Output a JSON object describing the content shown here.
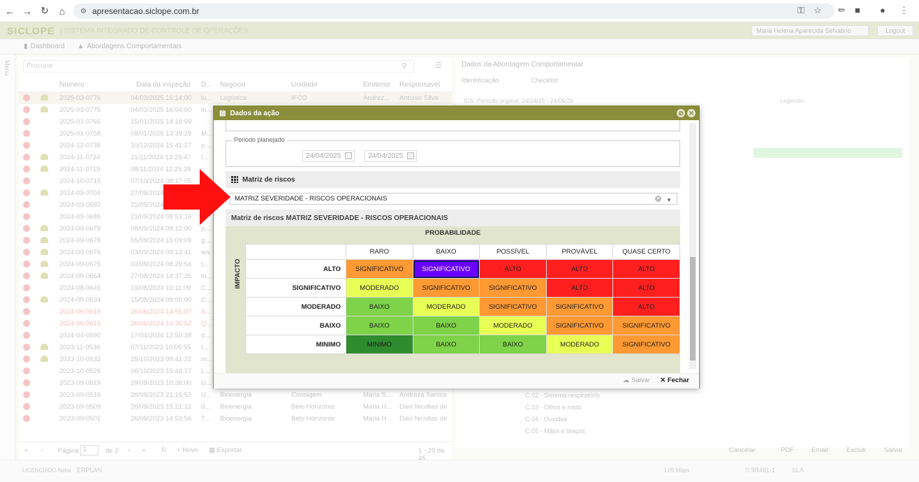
{
  "browser": {
    "url": "apresentacao.siclope.com.br"
  },
  "app": {
    "logo": "SICLOPE",
    "title": "| SISTEMA INTEGRADO DE CONTROLE DE OPERAÇÕES",
    "user": "Maria Helena Aparecida Selvatino",
    "logout": "Logout",
    "menu_label": "Menu",
    "tabs": [
      "Dashboard",
      "Abordagens Comportamentais"
    ],
    "search_placeholder": "Procurar",
    "columns": [
      "Número",
      "Data da inspeção",
      "D...",
      "Negócio",
      "Unidade",
      "Emitente",
      "Responsavel"
    ],
    "rows": [
      [
        "2025-03-0776",
        "04/03/2025 16:14:00",
        "lo...",
        "Logística",
        "IFCO",
        "Andrez...",
        "Antonio Silva"
      ],
      [
        "2025-03-0775",
        "04/03/2025 16:04:50",
        "lo...",
        "",
        "",
        "",
        ""
      ],
      [
        "2025-01-0765",
        "15/01/2025 14:19:59",
        "",
        "",
        "",
        "",
        ""
      ],
      [
        "2025-01-0758",
        "08/01/2025 13:39:29",
        "M...",
        "",
        "",
        "",
        ""
      ],
      [
        "2024-12-0738",
        "10/12/2024 15:41:27",
        "p...",
        "",
        "",
        "",
        ""
      ],
      [
        "2024-11-0724",
        "21/11/2024 13:25:47",
        "t...",
        "",
        "",
        "",
        ""
      ],
      [
        "2024-11-0719",
        "08/11/2024 12:25:29",
        "",
        "",
        "",
        "",
        ""
      ],
      [
        "2024-10-0715",
        "07/10/2024 08:17:05",
        "",
        "",
        "",
        "",
        ""
      ],
      [
        "2024-09-0704",
        "27/09/2024",
        "",
        "",
        "",
        "",
        ""
      ],
      [
        "2024-09-0692",
        "21/09/2024",
        "",
        "",
        "",
        "",
        ""
      ],
      [
        "2024-09-0686",
        "21/09/2024 08:53:16",
        "",
        "",
        "",
        "",
        ""
      ],
      [
        "2024-09-0679",
        "08/09/2024 08:12:00",
        "p...",
        "",
        "",
        "",
        ""
      ],
      [
        "2024-09-0678",
        "05/09/2024 15:09:09",
        "g...",
        "",
        "",
        "",
        ""
      ],
      [
        "2024-09-0676",
        "03/09/2024 09:13:41",
        "tes",
        "",
        "",
        "",
        ""
      ],
      [
        "2024-09-0675",
        "03/09/2024 08:29:54",
        "t...",
        "",
        "",
        "",
        ""
      ],
      [
        "2024-08-0664",
        "27/08/2024 14:37:26",
        "lo...",
        "",
        "",
        "",
        ""
      ],
      [
        "2024-08-0641",
        "19/08/2024 10:11:09",
        "C...",
        "",
        "",
        "",
        ""
      ],
      [
        "2024-08-0634",
        "15/08/2024 09:00:00",
        "C...",
        "",
        "",
        "",
        ""
      ],
      [
        "2024-06-0618",
        "26/06/2024 14:55:07",
        "S...",
        "",
        "",
        "",
        ""
      ],
      [
        "2024-06-0615",
        "26/06/2024 14:35:52",
        "Q...",
        "",
        "",
        "",
        ""
      ],
      [
        "2024-04-0590",
        "17/04/2024 12:50:38",
        "d...",
        "",
        "",
        "",
        ""
      ],
      [
        "2023-11-0536",
        "07/11/2023 10:05:55",
        "t...",
        "",
        "",
        "",
        ""
      ],
      [
        "2023-10-0532",
        "25/10/2023 09:41:22",
        "m...",
        "",
        "",
        "",
        ""
      ],
      [
        "2023-10-0526",
        "06/10/2023 15:44:17",
        "L...",
        "",
        "",
        "",
        ""
      ],
      [
        "2023-09-0519",
        "29/09/2023 10:38:00",
        "U...",
        "",
        "",
        "",
        ""
      ],
      [
        "2023-09-0516",
        "28/09/2023 21:16:53",
        "U...",
        "Bioenergia",
        "Contagem",
        "Maria S...",
        "Andreza Santos"
      ],
      [
        "2023-09-0509",
        "26/09/2023 15:21:12",
        "d...",
        "Bioenergia",
        "Belo Horizonte",
        "Maria H...",
        "Davi Nicollas de"
      ],
      [
        "2023-09-0501",
        "26/09/2023 14:53:56",
        "T...",
        "Bioenergia",
        "Belo Horizonte",
        "Maria H...",
        "Davi Nicollas de"
      ]
    ],
    "pager": {
      "page_label": "Página",
      "page": "1",
      "of": "de 2",
      "new": "Novo",
      "export": "Exportar",
      "count": "1 - 29 de 45"
    },
    "right": {
      "title": "Dados da Abordagem Comportamental",
      "tabs": [
        "Identificação",
        "Checklist"
      ],
      "ics": "ICS:   Período original: 24/04/25 - 24/06/25",
      "legend": "Legenda:",
      "checklist": [
        "C.02 - Sistema respiratório",
        "C.03 - Olhos e rosto",
        "C.04 - Ouvidos",
        "C.05 - Mãos e braços"
      ],
      "buttons": [
        "Cancelar",
        "PDF",
        "Email",
        "Excluir",
        "Salvar"
      ]
    },
    "status": {
      "left": "LICENCIADO Nsba",
      "brand": "ERPLAN",
      "speed": "1.09 Mbps",
      "version": "0.9R481-1",
      "sla": "SLA"
    }
  },
  "dialog": {
    "title": "Dados da ação",
    "periodo_label": "Periodo planejado",
    "date_start": "24/04/2025",
    "date_end": "24/04/2025",
    "matriz_title": "Matriz de riscos",
    "matriz_selected": "MATRIZ SEVERIDADE - RISCOS OPERACIONAIS",
    "matriz_subtitle": "Matriz de riscos MATRIZ SEVERIDADE - RISCOS OPERACIONAIS",
    "prob_label": "PROBABILIDADE",
    "impact_label": "IMPACTO",
    "salvar": "Salvar",
    "fechar": "Fechar"
  },
  "risk_matrix": {
    "columns": [
      "RARO",
      "BAIXO",
      "POSSÍVEL",
      "PROVÁVEL",
      "QUASE CERTO"
    ],
    "rows": [
      {
        "label": "ALTO",
        "cells": [
          "SIGNIFICATIVO",
          "SIGNIFICATIVO",
          "ALTO",
          "ALTO",
          "ALTO"
        ]
      },
      {
        "label": "SIGNIFICATIVO",
        "cells": [
          "MODERADO",
          "SIGNIFICATIVO",
          "SIGNIFICATIVO",
          "ALTO",
          "ALTO"
        ]
      },
      {
        "label": "MODERADO",
        "cells": [
          "BAIXO",
          "MODERADO",
          "SIGNIFICATIVO",
          "SIGNIFICATIVO",
          "ALTO"
        ]
      },
      {
        "label": "BAIXO",
        "cells": [
          "BAIXO",
          "BAIXO",
          "MODERADO",
          "SIGNIFICATIVO",
          "SIGNIFICATIVO"
        ]
      },
      {
        "label": "MINIMO",
        "cells": [
          "MINIMO",
          "BAIXO",
          "BAIXO",
          "MODERADO",
          "SIGNIFICATIVO"
        ]
      }
    ],
    "selected": {
      "row": 0,
      "col": 1
    },
    "colors": {
      "ALTO": "#ff1f1f",
      "SIGNIFICATIVO": "#ff9933",
      "MODERADO": "#e8ff55",
      "BAIXO": "#7ed348",
      "MINIMO": "#2e8b2e",
      "selected": "#6a00ff"
    }
  }
}
